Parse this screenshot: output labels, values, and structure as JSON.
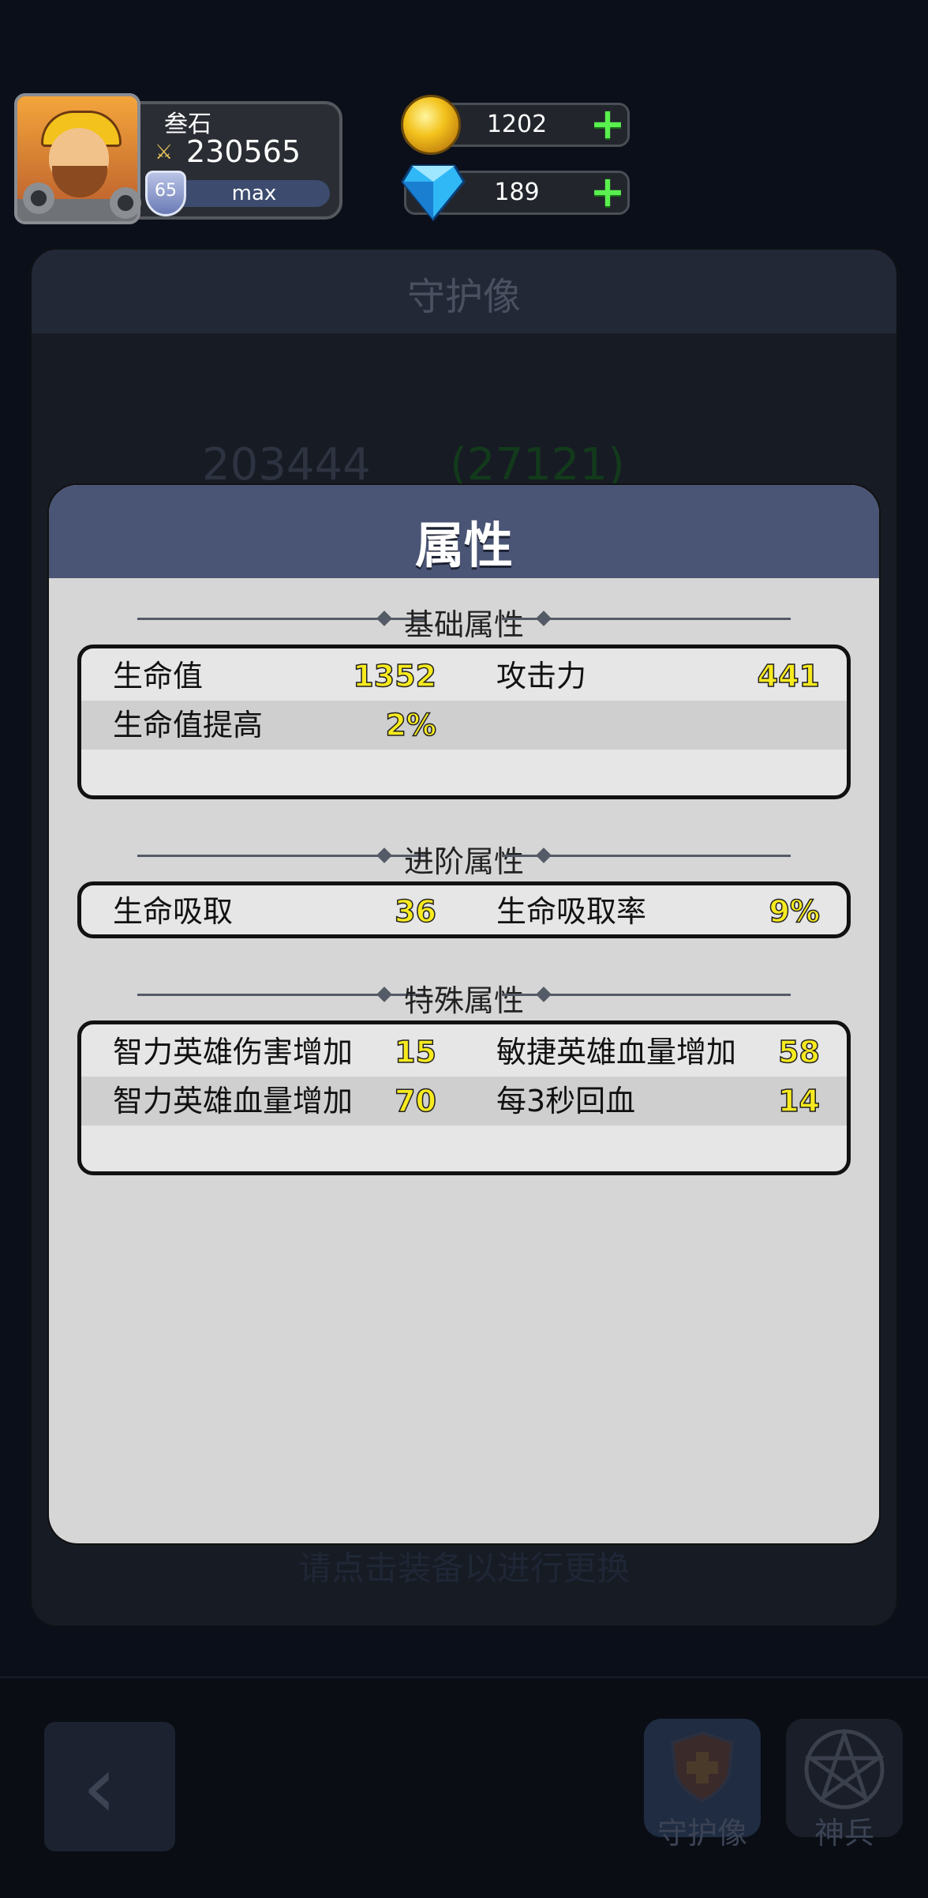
{
  "player": {
    "name": "叁石",
    "power": "230565",
    "level": "65",
    "exp_label": "max"
  },
  "currency": {
    "gold": "1202",
    "gems": "189"
  },
  "background": {
    "title": "守护像",
    "power": "203444",
    "bonus": "(27121)",
    "hint": "请点击装备以进行更换"
  },
  "bottom_nav": {
    "guardian": "守护像",
    "divine": "神兵"
  },
  "modal": {
    "title": "属性",
    "sections": {
      "basic": {
        "title": "基础属性",
        "rows": [
          {
            "l1": "生命值",
            "v1": "1352",
            "l2": "攻击力",
            "v2": "441"
          },
          {
            "l1": "生命值提高",
            "v1": "2%",
            "l2": "",
            "v2": ""
          }
        ]
      },
      "advanced": {
        "title": "进阶属性",
        "rows": [
          {
            "l1": "生命吸取",
            "v1": "36",
            "l2": "生命吸取率",
            "v2": "9%"
          }
        ]
      },
      "special": {
        "title": "特殊属性",
        "rows": [
          {
            "l1": "智力英雄伤害增加",
            "v1": "15",
            "l2": "敏捷英雄血量增加",
            "v2": "58"
          },
          {
            "l1": "智力英雄血量增加",
            "v1": "70",
            "l2": "每3秒回血",
            "v2": "14"
          }
        ]
      }
    }
  },
  "colors": {
    "modal_header": "#4a5576",
    "value_yellow": "#f7ea1f",
    "plus_green": "#5af04f"
  },
  "icons": [
    "settings-gear-icon",
    "power-swords-icon",
    "level-shield-icon",
    "gold-coin-icon",
    "diamond-gem-icon",
    "plus-icon",
    "back-arrow-icon",
    "guardian-shield-icon",
    "pentagram-icon"
  ]
}
